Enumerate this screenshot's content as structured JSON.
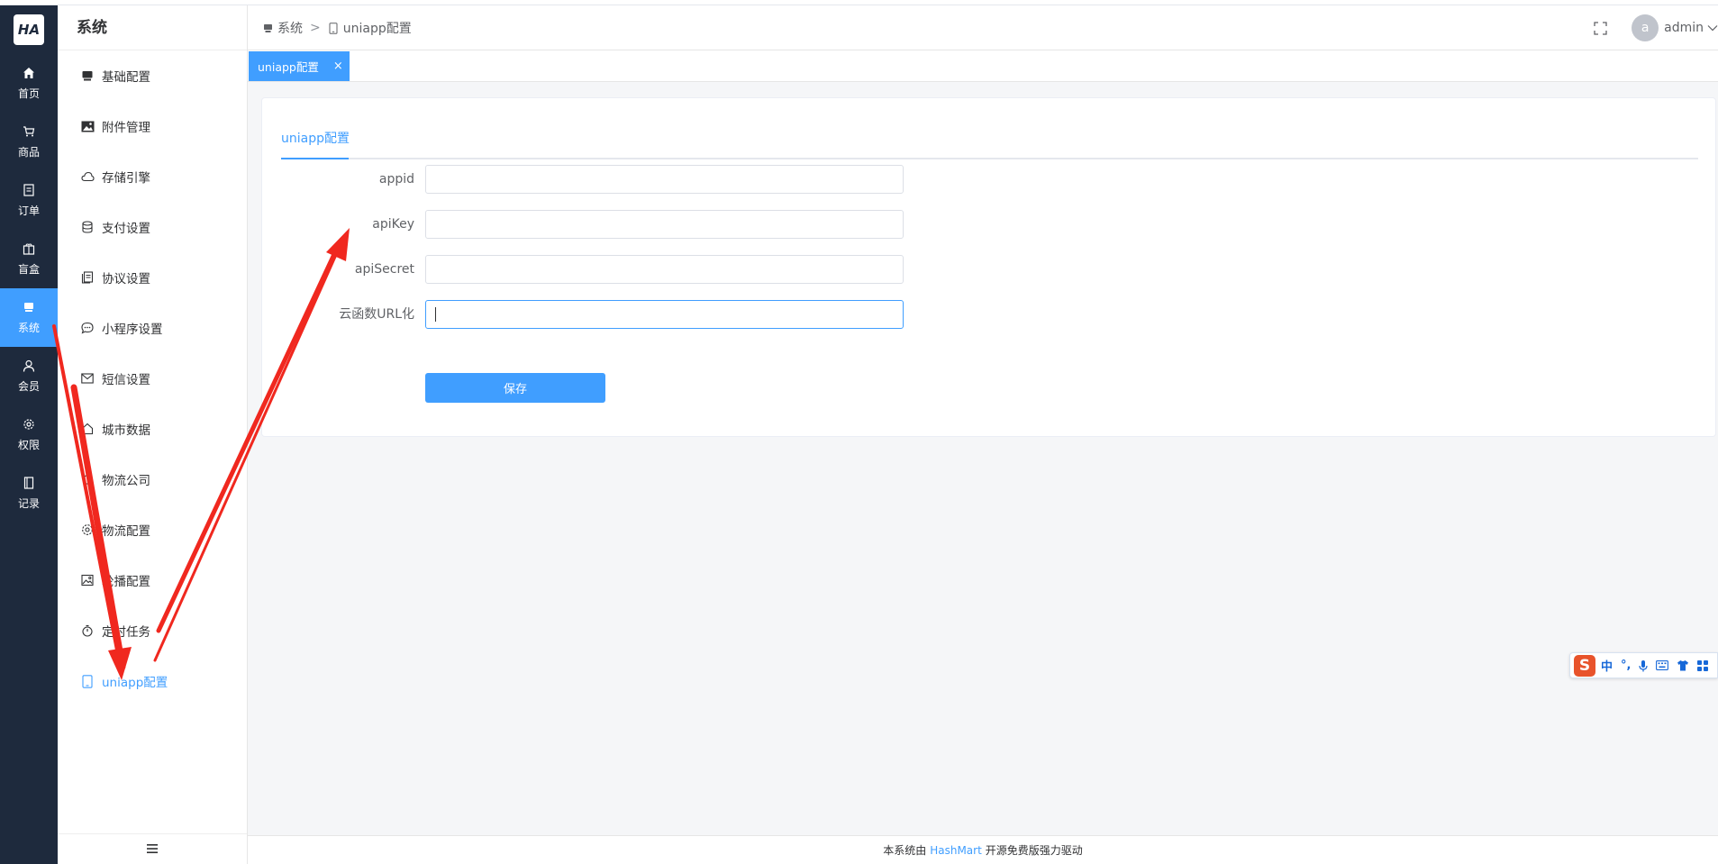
{
  "rail": {
    "logo": "HA",
    "items": [
      {
        "label": "首页",
        "icon": "home-icon",
        "active": false
      },
      {
        "label": "商品",
        "icon": "cart-icon",
        "active": false
      },
      {
        "label": "订单",
        "icon": "order-icon",
        "active": false
      },
      {
        "label": "盲盒",
        "icon": "box-icon",
        "active": false
      },
      {
        "label": "系统",
        "icon": "monitor-icon",
        "active": true
      },
      {
        "label": "会员",
        "icon": "user-icon",
        "active": false
      },
      {
        "label": "权限",
        "icon": "settings-icon",
        "active": false
      },
      {
        "label": "记录",
        "icon": "notebook-icon",
        "active": false
      }
    ]
  },
  "submenu": {
    "title": "系统",
    "items": [
      {
        "label": "基础配置",
        "icon": "monitor-icon"
      },
      {
        "label": "附件管理",
        "icon": "picture-icon"
      },
      {
        "label": "存储引擎",
        "icon": "cloud-icon"
      },
      {
        "label": "支付设置",
        "icon": "coins-icon"
      },
      {
        "label": "协议设置",
        "icon": "document-copy-icon"
      },
      {
        "label": "小程序设置",
        "icon": "chat-dot-icon"
      },
      {
        "label": "短信设置",
        "icon": "message-icon"
      },
      {
        "label": "城市数据",
        "icon": "house-icon"
      },
      {
        "label": "物流公司",
        "icon": "truck-icon"
      },
      {
        "label": "物流配置",
        "icon": "setting-icon"
      },
      {
        "label": "轮播配置",
        "icon": "picture-outline-icon"
      },
      {
        "label": "定时任务",
        "icon": "stopwatch-icon"
      },
      {
        "label": "uniapp配置",
        "icon": "cellphone-icon",
        "active": true
      }
    ],
    "collapse_icon": "menu-fold-icon"
  },
  "header": {
    "breadcrumb": [
      {
        "label": "系统",
        "icon": "monitor-icon"
      },
      {
        "label": "uniapp配置",
        "icon": "cellphone-icon"
      }
    ],
    "fullscreen_icon": "fullscreen-icon",
    "avatar_letter": "a",
    "username": "admin"
  },
  "tagsbar": {
    "active_tag": "uniapp配置",
    "close": "×"
  },
  "main": {
    "tab": "uniapp配置",
    "fields": [
      {
        "label": "appid",
        "value": "",
        "focused": false
      },
      {
        "label": "apiKey",
        "value": "",
        "focused": false
      },
      {
        "label": "apiSecret",
        "value": "",
        "focused": false
      },
      {
        "label": "云函数URL化",
        "value": "",
        "focused": true
      }
    ],
    "save_label": "保存"
  },
  "footer": {
    "prefix": "本系统由",
    "brand": "HashMart",
    "suffix": "开源免费版强力驱动"
  },
  "ime": {
    "logo": "S",
    "items": [
      "中",
      "°,",
      "🎤",
      "⌨",
      "👕",
      "▦"
    ]
  },
  "colors": {
    "primary": "#409eff",
    "rail_bg": "#1e2a3d",
    "arrow": "#f0281f",
    "ime_logo": "#e8532b"
  }
}
